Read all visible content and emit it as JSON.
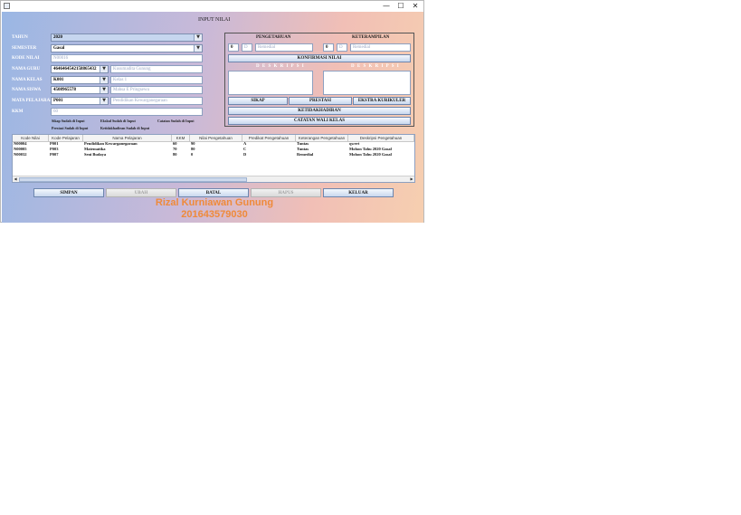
{
  "window": {
    "minimize": "—",
    "maximize": "☐",
    "close": "✕"
  },
  "header": {
    "title": "INPUT NILAI"
  },
  "form": {
    "tahun": {
      "label": "TAHUN",
      "value": "2020"
    },
    "semester": {
      "label": "SEMESTER",
      "value": "Gasal"
    },
    "kode_nilai": {
      "label": "KODE NILAI",
      "value": "N00016"
    },
    "nama_guru": {
      "label": "NAMA GURU",
      "value": "4646464542158865432",
      "name": "Kusumadita Gunung"
    },
    "nama_kelas": {
      "label": "NAMA KELAS",
      "value": "K001",
      "name": "Kelas 1"
    },
    "nama_siswa": {
      "label": "NAMA SISWA",
      "value": "4508965578",
      "name": "Mahsa E Pringsewu"
    },
    "mata_pelajaran": {
      "label": "MATA PELAJARAN",
      "value": "P001",
      "name": "Pendidikan Kewarganegaraan"
    },
    "kkm": {
      "label": "KKM",
      "value": "60"
    }
  },
  "notes": {
    "sikap": "Sikap Sudah di Input",
    "ekskul": "Ekskul Sudah di Input",
    "catatan": "Catatan Sudah di Input",
    "prestasi": "Prestasi Sudah di Input",
    "ketidakhadiran": "Ketidakhadiran Sudah di Input"
  },
  "panel": {
    "pengetahuan": {
      "label": "PENGETAHUAN",
      "nilai": "0",
      "predikat": "D",
      "keterangan": "Remedial"
    },
    "keterampilan": {
      "label": "KETERAMPILAN",
      "nilai": "0",
      "predikat": "D",
      "keterangan": "Remedial"
    },
    "konfirmasi": "KONFIRMASI NILAI",
    "deskripsi_left": "D E S K R I P S I",
    "deskripsi_right": "D E S K R I P S I",
    "sikap": "SIKAP",
    "prestasi": "PRESTASI",
    "ekstra": "EKSTRA KURIKULER",
    "ketidakhadiran": "KETIDAKHADIRAN",
    "catatan": "CATATAN WALI KELAS"
  },
  "table": {
    "columns": [
      "Kode Nilai",
      "Kode Pelajaran",
      "Nama Pelajaran",
      "KKM",
      "Nilai Pengetahuan",
      "Predikat Pengetahuan",
      "Keterangan Pengetahuan",
      "Deskripsi Pengetahuan"
    ],
    "rows": [
      [
        "N00004",
        "P001",
        "Pendidikan Kewarganegaraan",
        "60",
        "90",
        "A",
        "Tuntas",
        "qwert"
      ],
      [
        "N00005",
        "P003",
        "Matematika",
        "70",
        "80",
        "C",
        "Tuntas",
        "Mohon Tahu 2020 Gasal"
      ],
      [
        "N00032",
        "P007",
        "Seni Budaya",
        "80",
        "0",
        "D",
        "Remedial",
        "Mohon Tahu 2020 Gasal"
      ]
    ]
  },
  "actions": {
    "simpan": "SIMPAN",
    "ubah": "UBAH",
    "batal": "BATAL",
    "hapus": "HAPUS",
    "keluar": "KELUAR"
  },
  "watermark": {
    "name": "Rizal Kurniawan Gunung",
    "id": "201643579030"
  },
  "colors": {
    "watermark": "#ef8a3a"
  }
}
